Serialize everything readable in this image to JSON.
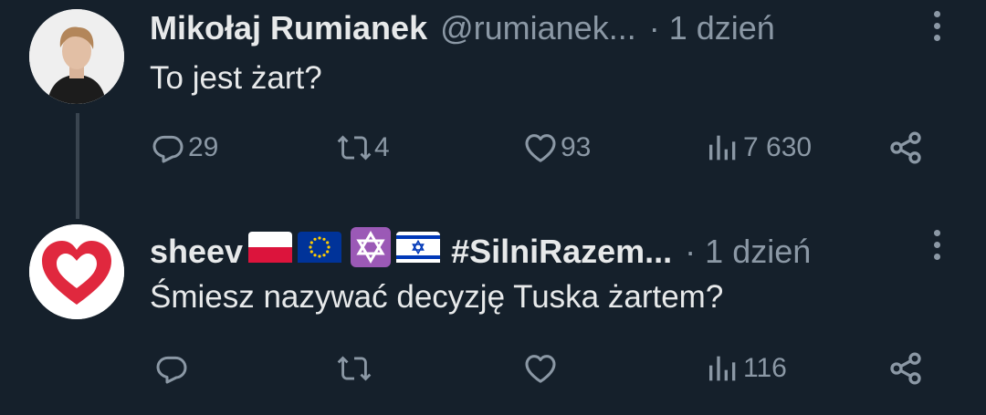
{
  "tweets": [
    {
      "author_name": "Mikołaj Rumianek",
      "handle": "@rumianek...",
      "separator": "·",
      "time": "1 dzień",
      "text": "To jest żart?",
      "replies": "29",
      "retweets": "4",
      "likes": "93",
      "views": "7 630",
      "avatar": "person-photo"
    },
    {
      "author_name": "sheev",
      "name_suffix": "#SilniRazem...",
      "separator": "·",
      "time": "1 dzień",
      "text": "Śmiesz nazywać decyzję Tuska żartem?",
      "replies": "",
      "retweets": "",
      "likes": "",
      "views": "116",
      "avatar": "red-heart-logo",
      "flags": [
        "poland-flag",
        "eu-flag",
        "star-of-david",
        "israel-flag"
      ]
    }
  ],
  "colors": {
    "background": "#15202b",
    "text": "#e7e9ea",
    "muted": "#8b98a5",
    "heart": "#e0283e"
  },
  "icons": [
    "reply-icon",
    "retweet-icon",
    "like-icon",
    "views-icon",
    "share-icon",
    "more-icon"
  ]
}
